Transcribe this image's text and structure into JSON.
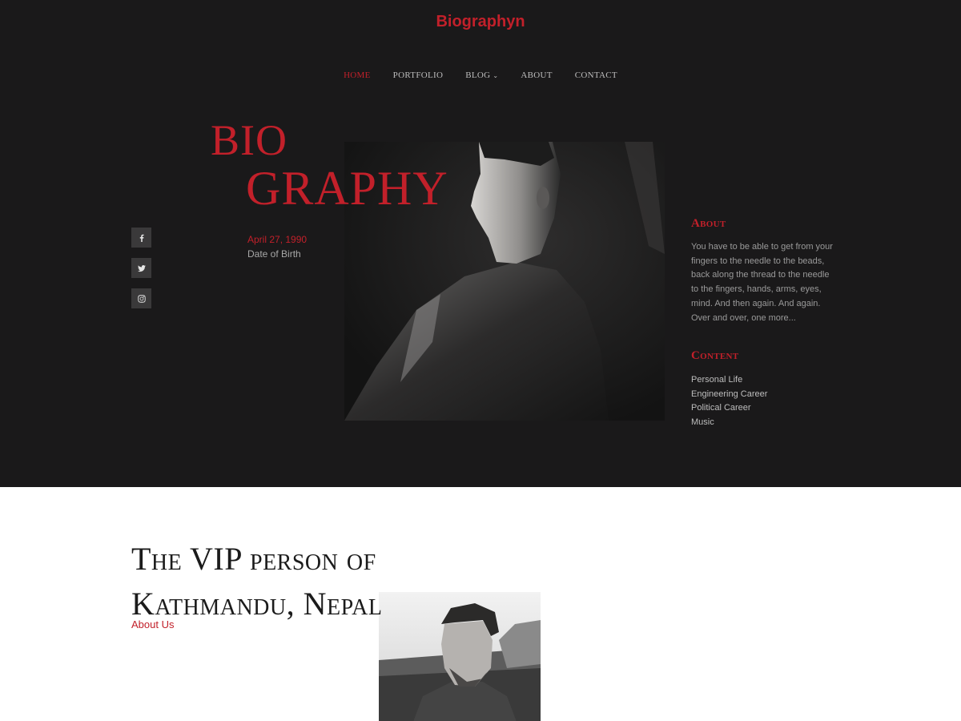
{
  "site": {
    "title": "Biographyn"
  },
  "nav": {
    "items": [
      {
        "label": "HOME",
        "active": true
      },
      {
        "label": "PORTFOLIO"
      },
      {
        "label": "BLOG",
        "has_dropdown": true
      },
      {
        "label": "ABOUT"
      },
      {
        "label": "CONTACT"
      }
    ]
  },
  "hero": {
    "title_line1": "BIO",
    "title_line2": "GRAPHY",
    "dob": {
      "date": "April 27, 1990",
      "label": "Date of Birth"
    },
    "social": [
      {
        "icon": "facebook-icon"
      },
      {
        "icon": "twitter-icon"
      },
      {
        "icon": "instagram-icon"
      }
    ]
  },
  "sidebar": {
    "about_heading": "About",
    "about_text": "You have to be able to get from your fingers to the needle to the beads, back along the thread to the needle to the fingers, hands, arms, eyes, mind. And then again. And again. Over and over, one more...",
    "content_heading": "Content",
    "content_items": [
      "Personal Life",
      "Engineering Career",
      "Political Career",
      "Music"
    ]
  },
  "section": {
    "title": "The VIP person of Kathmandu, Nepal",
    "link": "About Us"
  },
  "colors": {
    "accent": "#c2202a",
    "dark_bg": "#1a191a",
    "light_bg": "#ffffff"
  }
}
